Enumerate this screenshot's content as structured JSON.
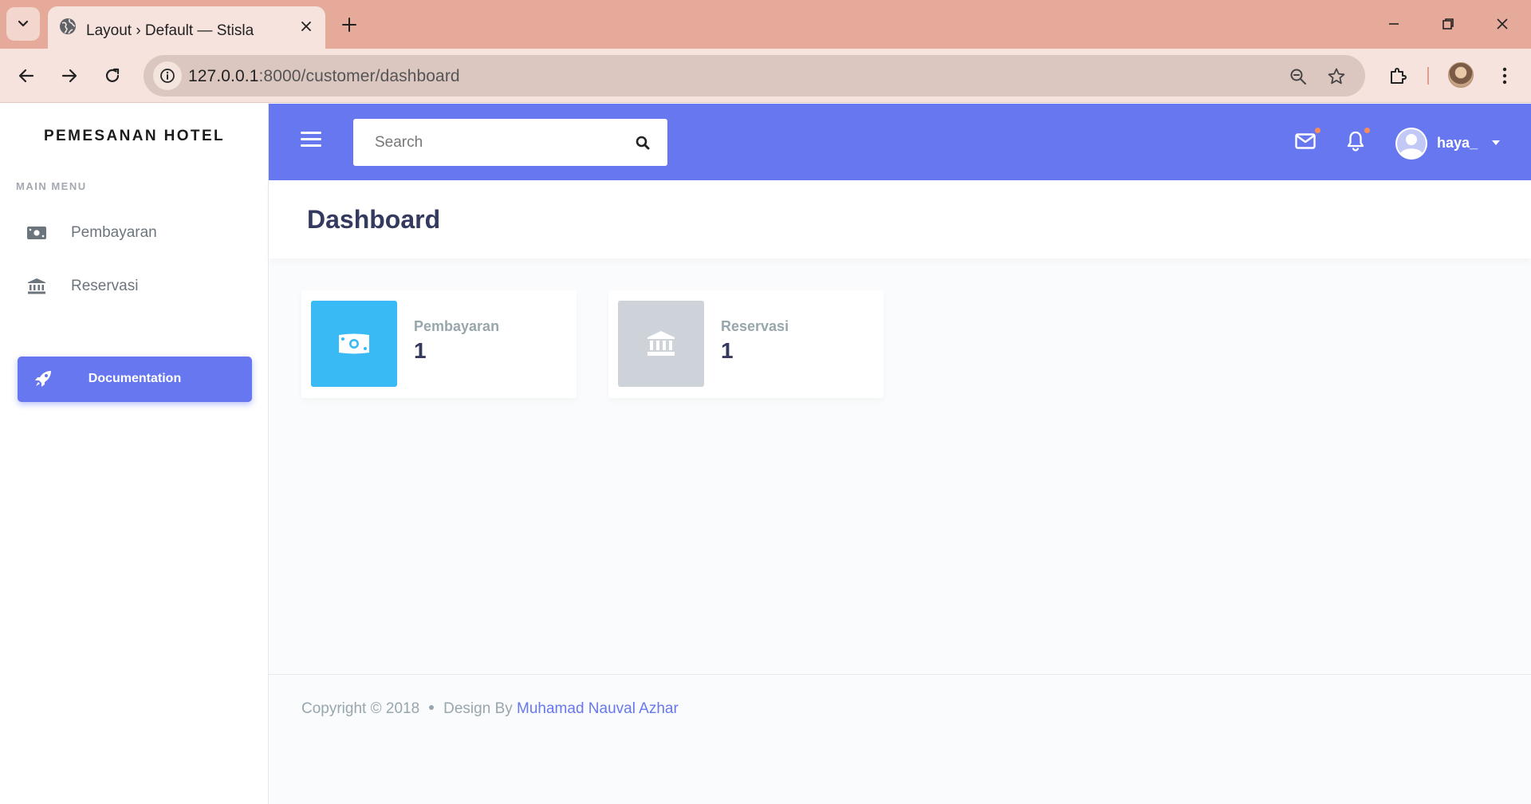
{
  "browser": {
    "tab_title": "Layout › Default — Stisla",
    "url_host": "127.0.0.1",
    "url_rest": ":8000/customer/dashboard"
  },
  "sidebar": {
    "brand": "PEMESANAN HOTEL",
    "menu_header": "MAIN MENU",
    "items": [
      {
        "label": "Pembayaran",
        "icon": "money-icon"
      },
      {
        "label": "Reservasi",
        "icon": "bank-icon"
      }
    ],
    "doc_button": "Documentation"
  },
  "navbar": {
    "search_placeholder": "Search",
    "user_name": "haya_",
    "accent": "#6777ef"
  },
  "main": {
    "title": "Dashboard",
    "cards": [
      {
        "label": "Pembayaran",
        "value": "1",
        "color": "#3abaf4",
        "icon": "money-icon"
      },
      {
        "label": "Reservasi",
        "value": "1",
        "color": "#cdd3d8",
        "icon": "bank-icon"
      }
    ]
  },
  "footer": {
    "copyright": "Copyright © 2018",
    "design_by": "Design By",
    "author": "Muhamad Nauval Azhar"
  }
}
